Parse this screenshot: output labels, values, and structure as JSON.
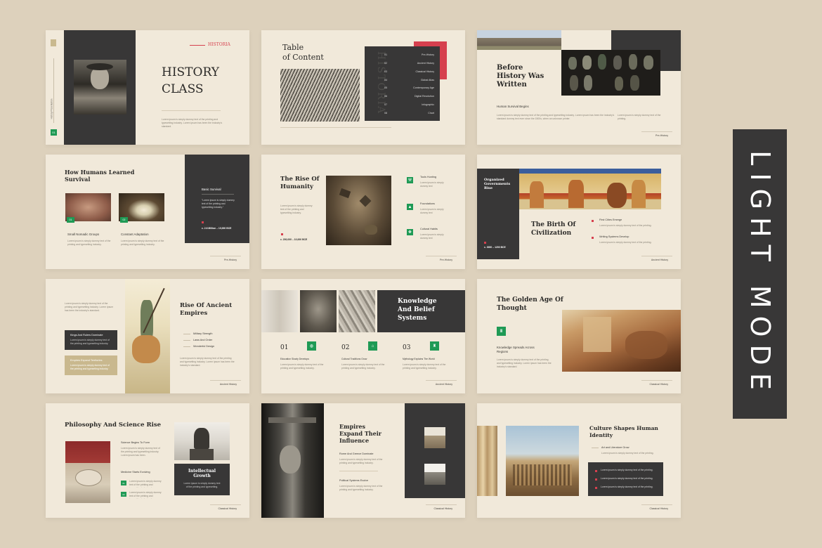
{
  "badge": "LIGHT MODE",
  "s1": {
    "kicker": "HISTORIA",
    "title1": "HISTORY",
    "title2": "CLASS",
    "vert": "History Presentation",
    "num": "01",
    "body": "Lorem ipsum is simply dummy text of the printing and typesetting industry. Lorem ipsum has been the industry's standard."
  },
  "s2": {
    "title1": "Table",
    "title2": "of Content",
    "watermark": "HISTORIA",
    "toc": [
      {
        "n": "01",
        "l": "Pre-History"
      },
      {
        "n": "02",
        "l": "Ancient History"
      },
      {
        "n": "03",
        "l": "Classical History"
      },
      {
        "n": "04",
        "l": "Global Atlas"
      },
      {
        "n": "05",
        "l": "Contemporary Age"
      },
      {
        "n": "06",
        "l": "Digital Revolution"
      },
      {
        "n": "07",
        "l": "Infographic"
      },
      {
        "n": "08",
        "l": "Chart"
      }
    ]
  },
  "s3": {
    "title1": "Before",
    "title2": "History Was",
    "title3": "Written",
    "sub": "Human Survival Begins",
    "body1": "Lorem ipsum is simply dummy text of the printing and typesetting industry. Lorem ipsum has been the industry's standard dummy text ever since the 1500s, when an unknown printer.",
    "body2": "Lorem ipsum is simply dummy text of the printing.",
    "foot": "Pre-History"
  },
  "s4": {
    "title1": "How Humans Learned",
    "title2": "Survival",
    "cap1": "Small Nomadic Groups",
    "cap2": "Constant Adaptation",
    "n1": "01",
    "n2": "02",
    "body": "Lorem ipsum is simply dummy text of the printing and typesetting industry.",
    "dtitle": "Basic Survival",
    "dquote": "\"Lorem ipsum is simply dummy text of the printing and typesetting industry.\"",
    "ddate": "c. 2.6 Million – 10,000 BCE",
    "foot": "Pre-History"
  },
  "s5": {
    "title1": "The Rise Of",
    "title2": "Humanity",
    "body": "Lorem ipsum is simply dummy text of the printing and typesetting industry.",
    "date": "c. 200,000 – 10,000 BCE",
    "items": [
      {
        "l": "Tools Hunting",
        "d": "Lorem ipsum is simply dummy text"
      },
      {
        "l": "Foundations",
        "d": "Lorem ipsum is simply dummy text"
      },
      {
        "l": "Cultural Habits",
        "d": "Lorem ipsum is simply dummy text"
      }
    ],
    "foot": "Pre-History"
  },
  "s6": {
    "dtitle1": "Organized",
    "dtitle2": "Governments",
    "dtitle3": "Rise",
    "ddate": "c. 3000 – 1200 BCE",
    "title1": "The Birth Of",
    "title2": "Civilization",
    "b1": "First Cities Emerge",
    "b2": "Writing Systems Develop",
    "bd": "Lorem ipsum is simply dummy text of the printing.",
    "foot": "Ancient History"
  },
  "s7": {
    "title1": "Rise Of Ancient",
    "title2": "Empires",
    "intro": "Lorem ipsum is simply dummy text of the printing and typesetting industry. Lorem ipsum has been the industry's standard.",
    "box1": "Kings And Rulers Dominate",
    "box2": "Empires Expand Territories",
    "items": [
      "Military Strength",
      "Laws And Order",
      "Wonderful Design"
    ],
    "body": "Lorem ipsum is simply dummy text of the printing and typesetting industry. Lorem ipsum has been the industry's standard.",
    "foot": "Ancient History"
  },
  "s8": {
    "title1": "Knowledge",
    "title2": "And Belief",
    "title3": "Systems",
    "cols": [
      {
        "n": "01",
        "l": "Education Slowly Develops"
      },
      {
        "n": "02",
        "l": "Cultural Traditions Grow"
      },
      {
        "n": "03",
        "l": "Mythology Explains The World"
      }
    ],
    "body": "Lorem ipsum is simply dummy text of the printing and typesetting industry.",
    "foot": "Ancient History"
  },
  "s9": {
    "title1": "The Golden Age Of",
    "title2": "Thought",
    "sub1": "Knowledge Spreads Across",
    "sub2": "Regions",
    "body": "Lorem ipsum is simply dummy text of the printing and typesetting industry. Lorem ipsum has been the industry's standard.",
    "foot": "Classical History"
  },
  "s10": {
    "title": "Philosophy And Science Rise",
    "h1": "Science Begins To Form",
    "h2": "Medicine Starts Evolving",
    "body": "Lorem ipsum is simply dummy text of the printing and typesetting industry. Lorem ipsum has been.",
    "n1": "01",
    "n2": "02",
    "dtitle1": "Intellectual",
    "dtitle2": "Growth",
    "dbody": "Lorem ipsum is simply dummy text of the printing and typesetting.",
    "foot": "Classical History"
  },
  "s11": {
    "title1": "Empires",
    "title2": "Expand Their",
    "title3": "Influence",
    "h1": "Rome And Greece Dominate",
    "h2": "Political Systems Evolve",
    "body": "Lorem ipsum is simply dummy text of the printing and typesetting industry.",
    "foot": "Classical History"
  },
  "s12": {
    "title1": "Culture Shapes Human",
    "title2": "Identity",
    "sub": "Art and Literature Grow",
    "body": "Lorem ipsum is simply dummy text of the printing.",
    "items": [
      "Lorem ipsum is simply dummy text of the printing.",
      "Lorem ipsum is simply dummy text of the printing.",
      "Lorem ipsum is simply dummy text of the printing."
    ],
    "foot": "Classical History"
  },
  "colors": {
    "bg": "#ddd1bc",
    "slide": "#f1e9da",
    "dark": "#383737",
    "green": "#1f9a55",
    "red": "#d6404e"
  }
}
